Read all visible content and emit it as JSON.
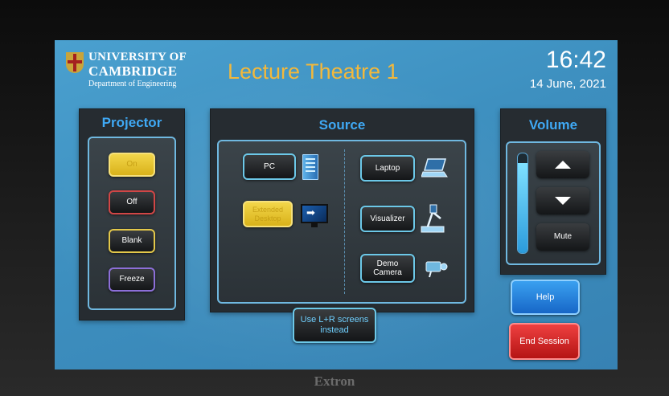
{
  "header": {
    "university_line1": "UNIVERSITY OF",
    "university_line2": "CAMBRIDGE",
    "department": "Department of Engineering",
    "room_title": "Lecture Theatre 1",
    "time": "16:42",
    "date": "14 June, 2021"
  },
  "projector": {
    "title": "Projector",
    "buttons": [
      {
        "label": "On",
        "state": "active"
      },
      {
        "label": "Off"
      },
      {
        "label": "Blank"
      },
      {
        "label": "Freeze"
      }
    ]
  },
  "source": {
    "title": "Source",
    "buttons": [
      {
        "label": "PC",
        "icon": "pc-tower-icon"
      },
      {
        "label": "Extended Desktop",
        "icon": "monitor-icon",
        "state": "active"
      },
      {
        "label": "Laptop",
        "icon": "laptop-icon"
      },
      {
        "label": "Visualizer",
        "icon": "visualizer-icon"
      },
      {
        "label": "Demo Camera",
        "icon": "camera-icon"
      }
    ],
    "alt_button": "Use L+R screens instead"
  },
  "volume": {
    "title": "Volume",
    "level_fraction": 0.9,
    "mute_label": "Mute",
    "up_icon": "volume-up-icon",
    "down_icon": "volume-down-icon"
  },
  "actions": {
    "help_label": "Help",
    "end_session_label": "End Session"
  },
  "device": {
    "brand": "Extron"
  },
  "colors": {
    "screen_bg": "#3d8fbf",
    "title_blue": "#3fa9f5",
    "room_title": "#f3b83b",
    "active_yellow": "#e8c52c",
    "help_blue": "#1f7fe0",
    "end_red": "#d42424"
  }
}
